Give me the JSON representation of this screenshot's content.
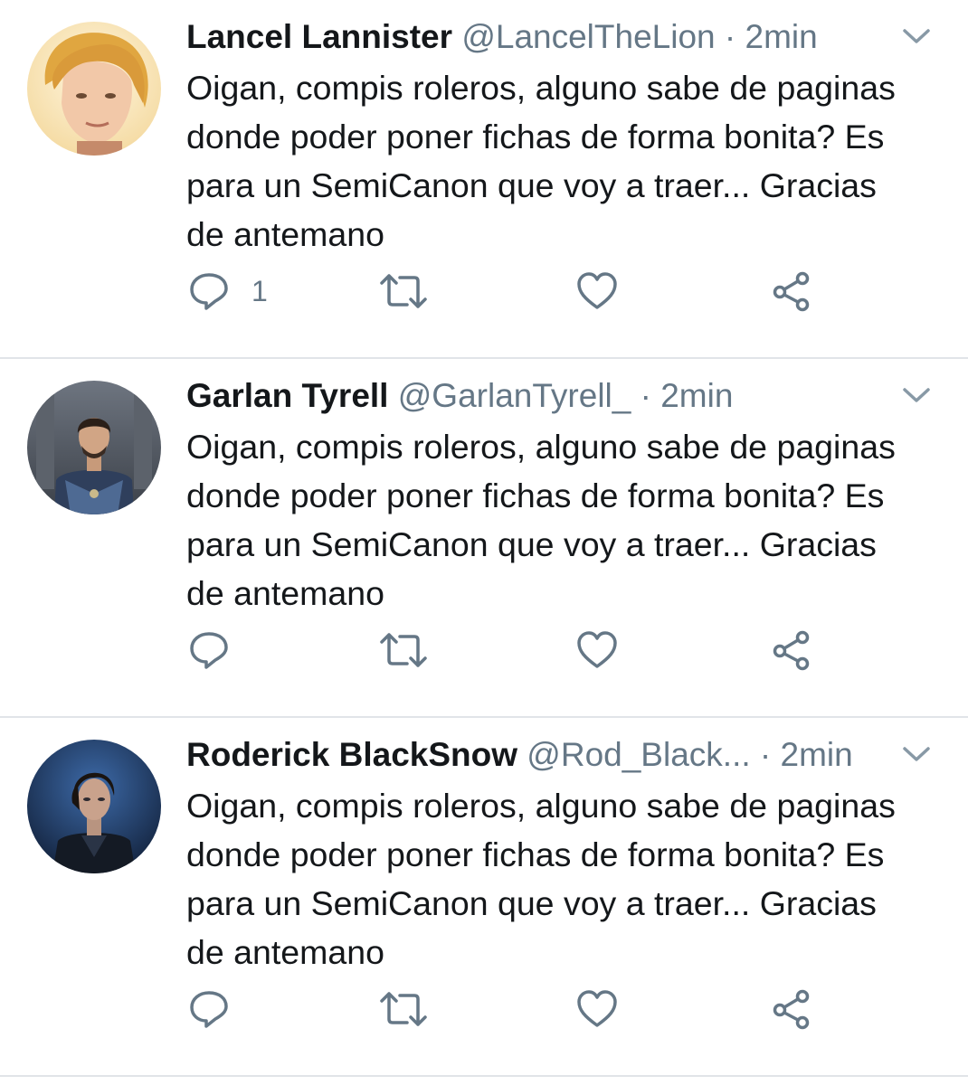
{
  "tweets": [
    {
      "display_name": "Lancel Lannister",
      "handle": "@LancelTheLion",
      "separator": "·",
      "time": "2min",
      "text": "Oigan, compis roleros, alguno sabe de paginas donde poder poner fichas de forma bonita? Es para un SemiCanon que voy a traer... Gracias de antemano",
      "reply_count": "1",
      "icons": [
        "chevron-down-icon",
        "reply-icon",
        "retweet-icon",
        "like-icon",
        "share-icon"
      ]
    },
    {
      "display_name": "Garlan Tyrell",
      "handle": "@GarlanTyrell_",
      "separator": "·",
      "time": "2min",
      "text": "Oigan, compis roleros, alguno sabe de paginas donde poder poner fichas de forma bonita? Es para un SemiCanon que voy a traer... Gracias de antemano",
      "reply_count": "",
      "icons": [
        "chevron-down-icon",
        "reply-icon",
        "retweet-icon",
        "like-icon",
        "share-icon"
      ]
    },
    {
      "display_name": "Roderick BlackSnow",
      "handle": "@Rod_Black...",
      "separator": "·",
      "time": "2min",
      "text": "Oigan, compis roleros, alguno sabe de paginas donde poder poner fichas de forma bonita? Es para un SemiCanon que voy a traer... Gracias de antemano",
      "reply_count": "",
      "icons": [
        "chevron-down-icon",
        "reply-icon",
        "retweet-icon",
        "like-icon",
        "share-icon"
      ]
    }
  ],
  "colors": {
    "text_primary": "#14171a",
    "text_secondary": "#657786",
    "divider": "#e1e4e8",
    "icon": "#657786"
  }
}
